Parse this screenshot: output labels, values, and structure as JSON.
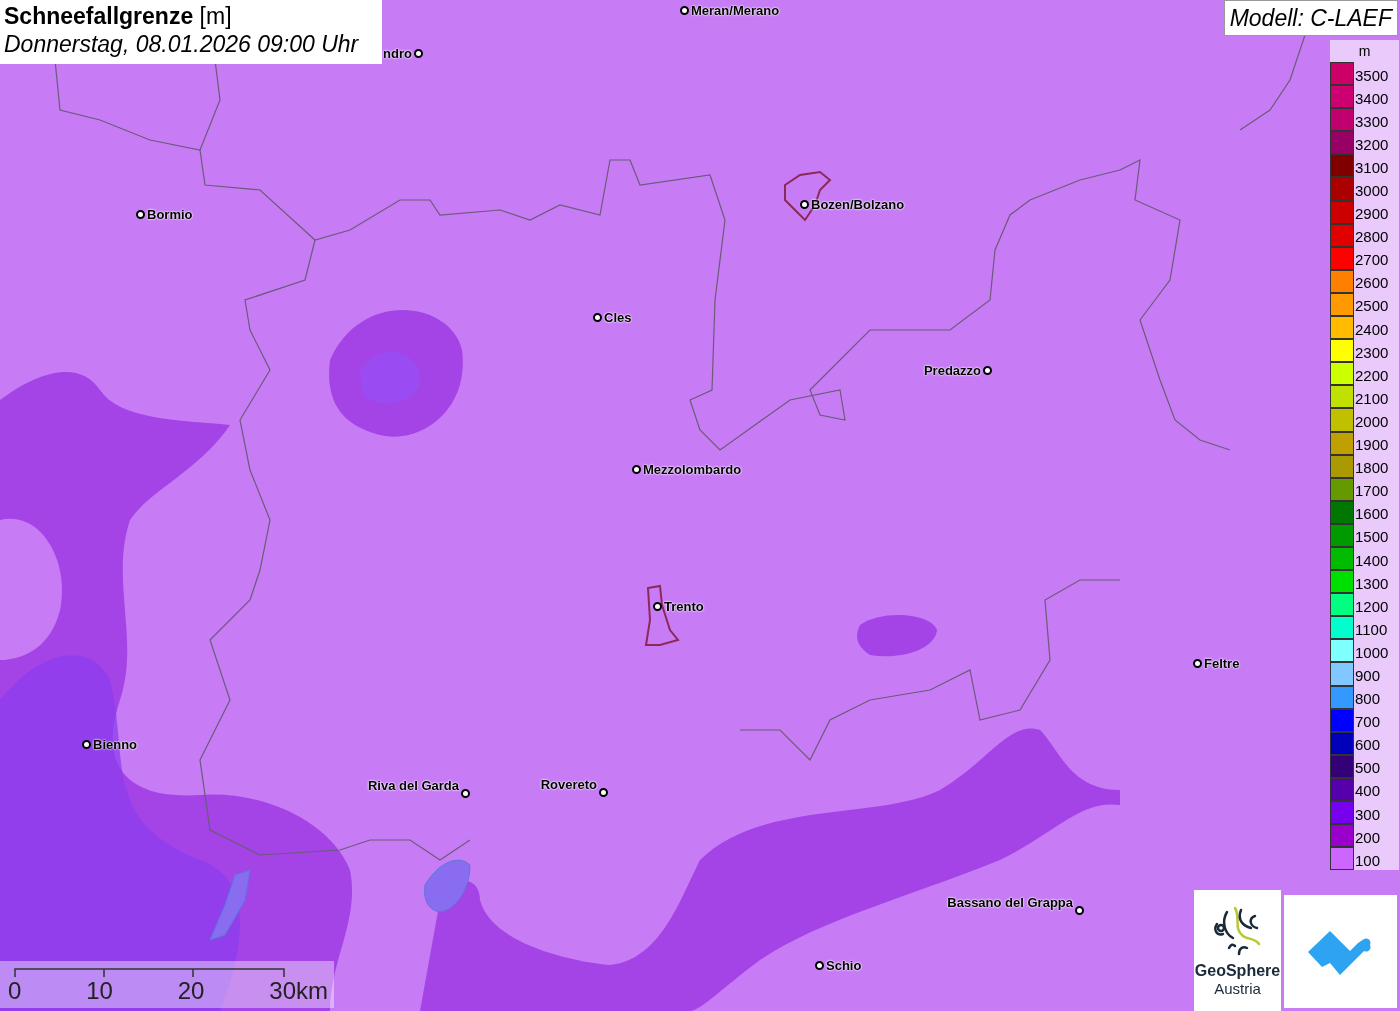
{
  "title": {
    "parameter": "Schneefallgrenze",
    "unit": "[m]",
    "datetime": "Donnerstag, 08.01.2026 09:00 Uhr"
  },
  "model": "Modell: C-LAEF",
  "cities": [
    {
      "name": "ndro",
      "kind": "left"
    },
    {
      "name": "Meran/Merano",
      "kind": "right"
    },
    {
      "name": "Bormio",
      "kind": "right"
    },
    {
      "name": "Bozen/Bolzano",
      "kind": "right"
    },
    {
      "name": "Cles",
      "kind": "right"
    },
    {
      "name": "Predazzo",
      "kind": "left"
    },
    {
      "name": "Mezzolombardo",
      "kind": "right"
    },
    {
      "name": "Trento",
      "kind": "right"
    },
    {
      "name": "Feltre",
      "kind": "right"
    },
    {
      "name": "Bienno",
      "kind": "right"
    },
    {
      "name": "Riva del Garda",
      "kind": "left"
    },
    {
      "name": "Rovereto",
      "kind": "left"
    },
    {
      "name": "Bassano del Grappa",
      "kind": "left"
    },
    {
      "name": "Schio",
      "kind": "right"
    }
  ],
  "legend": {
    "unit": "m",
    "entries": [
      {
        "label": "3500",
        "color": "#cc0066"
      },
      {
        "label": "3400",
        "color": "#cc0070"
      },
      {
        "label": "3300",
        "color": "#c0006e"
      },
      {
        "label": "3200",
        "color": "#990066"
      },
      {
        "label": "3100",
        "color": "#800000"
      },
      {
        "label": "3000",
        "color": "#aa0000"
      },
      {
        "label": "2900",
        "color": "#cc0000"
      },
      {
        "label": "2800",
        "color": "#e00000"
      },
      {
        "label": "2700",
        "color": "#ff0000"
      },
      {
        "label": "2600",
        "color": "#ff8000"
      },
      {
        "label": "2500",
        "color": "#ff9900"
      },
      {
        "label": "2400",
        "color": "#ffbb00"
      },
      {
        "label": "2300",
        "color": "#ffff00"
      },
      {
        "label": "2200",
        "color": "#ccff00"
      },
      {
        "label": "2100",
        "color": "#c0e000"
      },
      {
        "label": "2000",
        "color": "#c0c000"
      },
      {
        "label": "1900",
        "color": "#c0a000"
      },
      {
        "label": "1800",
        "color": "#aa9900"
      },
      {
        "label": "1700",
        "color": "#669900"
      },
      {
        "label": "1600",
        "color": "#007700"
      },
      {
        "label": "1500",
        "color": "#009900"
      },
      {
        "label": "1400",
        "color": "#00bb00"
      },
      {
        "label": "1300",
        "color": "#00e000"
      },
      {
        "label": "1200",
        "color": "#00ff80"
      },
      {
        "label": "1100",
        "color": "#00ffcc"
      },
      {
        "label": "1000",
        "color": "#80ffff"
      },
      {
        "label": "900",
        "color": "#80c8ff"
      },
      {
        "label": "800",
        "color": "#3399ff"
      },
      {
        "label": "700",
        "color": "#0000ff"
      },
      {
        "label": "600",
        "color": "#0000bb"
      },
      {
        "label": "500",
        "color": "#330077"
      },
      {
        "label": "400",
        "color": "#5500aa"
      },
      {
        "label": "300",
        "color": "#7700ee"
      },
      {
        "label": "200",
        "color": "#9900cc"
      },
      {
        "label": "100",
        "color": "#cc66ff"
      }
    ]
  },
  "scale_bar": [
    "0",
    "10",
    "20",
    "30km"
  ],
  "logo": {
    "name": "GeoSphere",
    "subtitle": "Austria"
  }
}
